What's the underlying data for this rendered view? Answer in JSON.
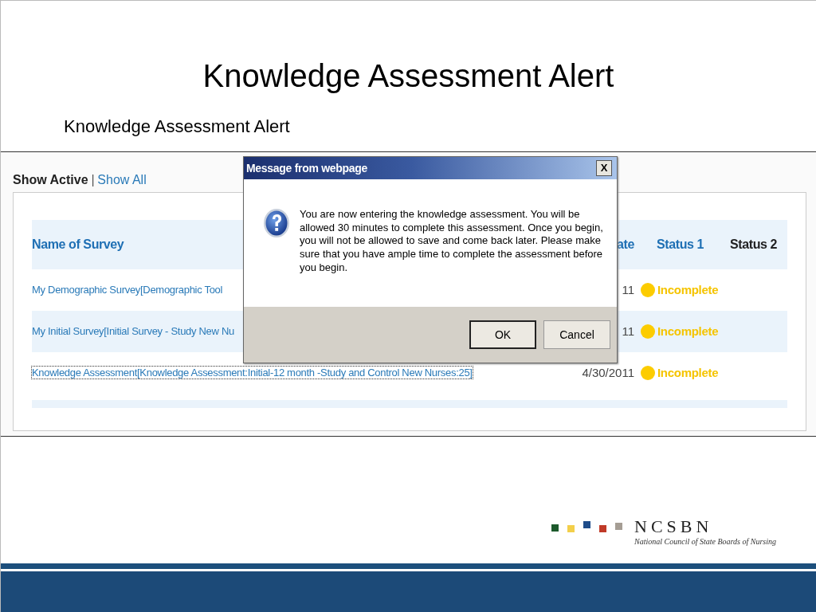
{
  "slide": {
    "title": "Knowledge Assessment Alert",
    "subtitle": "Knowledge Assessment Alert"
  },
  "screenshot": {
    "filters": [
      {
        "label": "Show Active",
        "selected": true
      },
      {
        "label": "Show All",
        "selected": false
      }
    ],
    "separator": "|",
    "table": {
      "columns": [
        {
          "label": "Name of Survey",
          "sortable": true
        },
        {
          "label": "ate",
          "sortable": true
        },
        {
          "label": "Status 1",
          "sortable": true
        },
        {
          "label": "Status 2",
          "sortable": false
        }
      ],
      "rows": [
        {
          "name": "My Demographic Survey[Demographic Tool",
          "date": "11",
          "status_1": "Incomplete",
          "focused": false
        },
        {
          "name": "My Initial Survey[Initial Survey - Study New Nu",
          "date": "11",
          "status_1": "Incomplete",
          "focused": false
        },
        {
          "name": "Knowledge Assessment[Knowledge Assessment:Initial-12 month -Study and Control New Nurses:25]",
          "date": "4/30/2011",
          "status_1": "Incomplete",
          "focused": true
        }
      ]
    },
    "dialog": {
      "title": "Message from webpage",
      "close": "X",
      "message": "You are now entering the knowledge assessment. You will be allowed 30 minutes to complete this assessment. Once you begin, you will not be allowed to save and come back later. Please make sure that you have ample time to complete the assessment before you begin.",
      "buttons": [
        {
          "label": "OK",
          "default": true
        },
        {
          "label": "Cancel",
          "default": false
        }
      ]
    }
  },
  "logo": {
    "name": "NCSBN",
    "tagline": "National Council of State Boards of Nursing"
  }
}
